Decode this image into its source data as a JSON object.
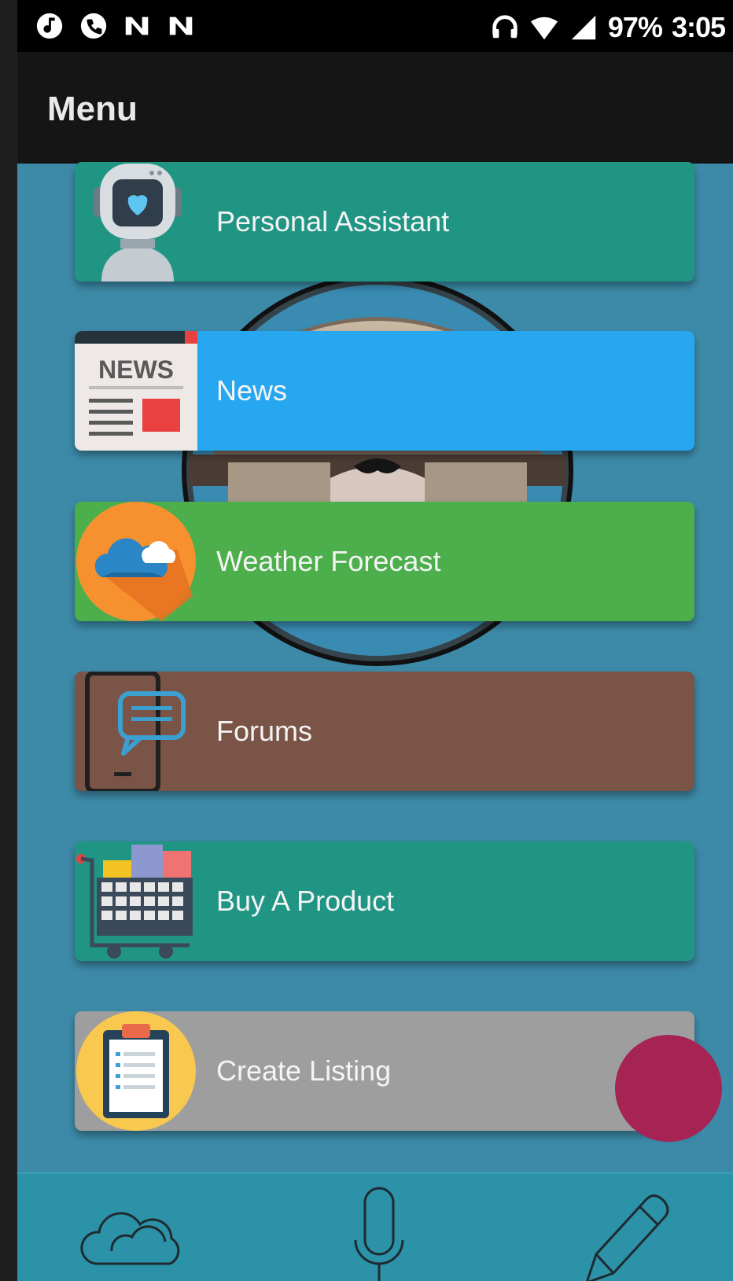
{
  "status_bar": {
    "battery": "97%",
    "time": "3:05"
  },
  "app_bar": {
    "title": "Menu"
  },
  "menu": {
    "items": [
      {
        "label": "Personal Assistant",
        "icon": "robot-icon",
        "color": "#219583"
      },
      {
        "label": "News",
        "icon": "newspaper-icon",
        "color": "#27a7ef"
      },
      {
        "label": "Weather Forecast",
        "icon": "cloud-sun-icon",
        "color": "#4daf4c"
      },
      {
        "label": "Forums",
        "icon": "chat-phone-icon",
        "color": "#7a5446"
      },
      {
        "label": "Buy A Product",
        "icon": "shopping-cart-icon",
        "color": "#219583"
      },
      {
        "label": "Create Listing",
        "icon": "clipboard-icon",
        "color": "#9e9e9e"
      }
    ],
    "news_icon_text": "NEWS"
  },
  "bottom_nav": {
    "items": [
      {
        "icon": "cloud-icon"
      },
      {
        "icon": "microphone-icon"
      },
      {
        "icon": "pencil-icon"
      }
    ]
  },
  "colors": {
    "background": "#3d8aa8",
    "app_bar": "#151515",
    "bottom_nav": "#2b92a8",
    "fab": "#a52454"
  }
}
